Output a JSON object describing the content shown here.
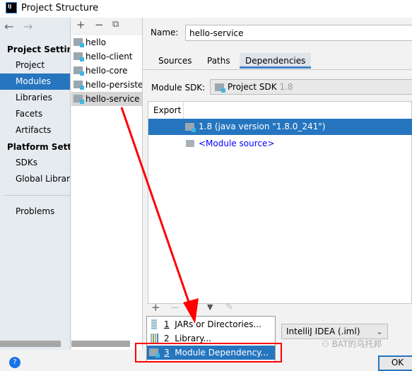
{
  "window": {
    "title": "Project Structure",
    "logo": "IJ"
  },
  "nav": {
    "back_icon": "arrow-left-icon",
    "forward_icon": "arrow-right-icon"
  },
  "sidebar": {
    "project_settings_header": "Project Settings",
    "project_items": [
      {
        "label": "Project"
      },
      {
        "label": "Modules",
        "selected": true
      },
      {
        "label": "Libraries"
      },
      {
        "label": "Facets"
      },
      {
        "label": "Artifacts"
      }
    ],
    "platform_settings_header": "Platform Settings",
    "platform_items": [
      {
        "label": "SDKs"
      },
      {
        "label": "Global Libraries"
      }
    ],
    "problems": "Problems"
  },
  "modules": {
    "items": [
      "hello",
      "hello-client",
      "hello-core",
      "hello-persistence",
      "hello-service"
    ],
    "selected": "hello-service"
  },
  "details": {
    "name_label": "Name:",
    "name_value": "hello-service",
    "tabs": [
      "Sources",
      "Paths",
      "Dependencies"
    ],
    "active_tab": "Dependencies",
    "sdk_label": "Module SDK:",
    "sdk_value": "Project SDK",
    "sdk_version": "1.8",
    "table_header": "Export",
    "rows": [
      "1.8 (java version \"1.8.0_241\")",
      "<Module source>"
    ],
    "format_value": "IntelliJ IDEA (.iml)",
    "ok": "OK"
  },
  "popup": {
    "items": [
      {
        "num": "1",
        "label": "JARs or Directories..."
      },
      {
        "num": "2",
        "label": "Library..."
      },
      {
        "num": "3",
        "label": "Module Dependency..."
      }
    ]
  },
  "watermark": "BAT的乌托邦",
  "colors": {
    "selection": "#2675bf",
    "annotation": "#ff0000",
    "link": "#0000ff"
  }
}
